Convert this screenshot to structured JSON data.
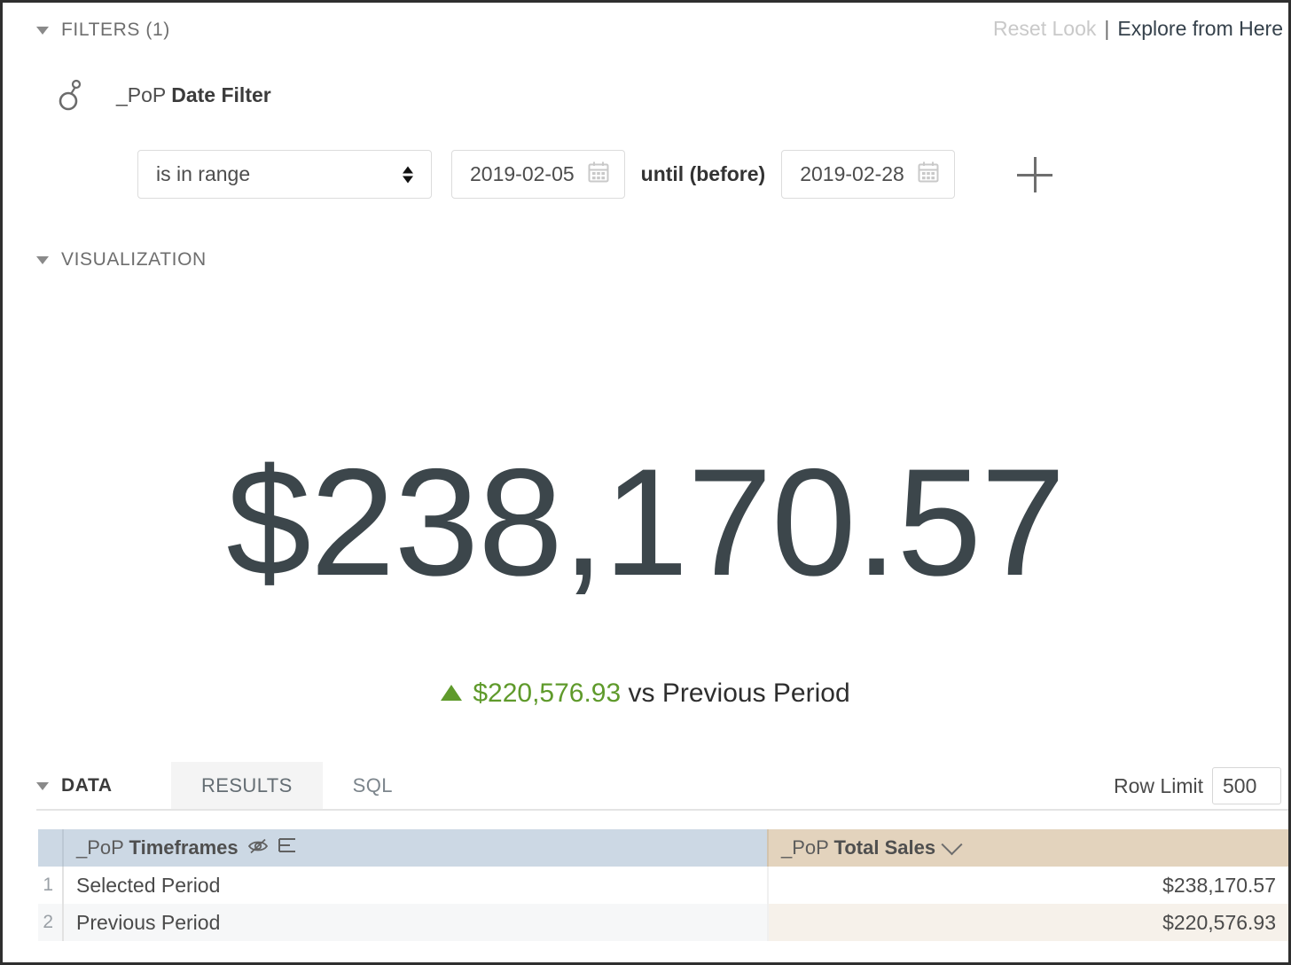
{
  "header": {
    "filters_label": "FILTERS (1)",
    "reset_link": "Reset Look",
    "separator": "|",
    "explore_link": "Explore from Here"
  },
  "filter": {
    "field_icon": "dimension-filter-icon",
    "field_prefix": "_PoP",
    "field_name": "Date Filter",
    "operator": "is in range",
    "start_date": "2019-02-05",
    "until_label": "until (before)",
    "end_date": "2019-02-28",
    "add_filter_icon": "plus-icon",
    "calendar_icon": "calendar-icon"
  },
  "visualization": {
    "section_label": "VISUALIZATION",
    "value": "$238,170.57",
    "comparison": {
      "direction_icon": "triangle-up-icon",
      "value": "$220,576.93",
      "suffix": "vs Previous Period",
      "positive_color": "#5f9a2b"
    }
  },
  "data": {
    "section_label": "DATA",
    "tabs": [
      {
        "label": "RESULTS",
        "active": true
      },
      {
        "label": "SQL",
        "active": false
      }
    ],
    "row_limit_label": "Row Limit",
    "row_limit_value": "500",
    "table": {
      "columns": [
        {
          "prefix": "_PoP",
          "name": "Timeframes",
          "type": "dimension",
          "header_color": "#ccd8e4",
          "icons": [
            "eye-slash-icon",
            "filter-lines-icon"
          ]
        },
        {
          "prefix": "_PoP",
          "name": "Total Sales",
          "type": "measure",
          "header_color": "#e3d3bd",
          "icons": [
            "chevron-down-icon"
          ]
        }
      ],
      "rows": [
        {
          "num": "1",
          "timeframe": "Selected Period",
          "total_sales": "$238,170.57"
        },
        {
          "num": "2",
          "timeframe": "Previous Period",
          "total_sales": "$220,576.93"
        }
      ]
    }
  },
  "chart_data": {
    "type": "table",
    "title": "_PoP Total Sales by _PoP Timeframes",
    "categories": [
      "Selected Period",
      "Previous Period"
    ],
    "values": [
      238170.57,
      220576.93
    ],
    "ylabel": "_PoP Total Sales",
    "xlabel": "_PoP Timeframes",
    "annotations": [
      "$238,170.57",
      "▲ $220,576.93 vs Previous Period"
    ]
  }
}
